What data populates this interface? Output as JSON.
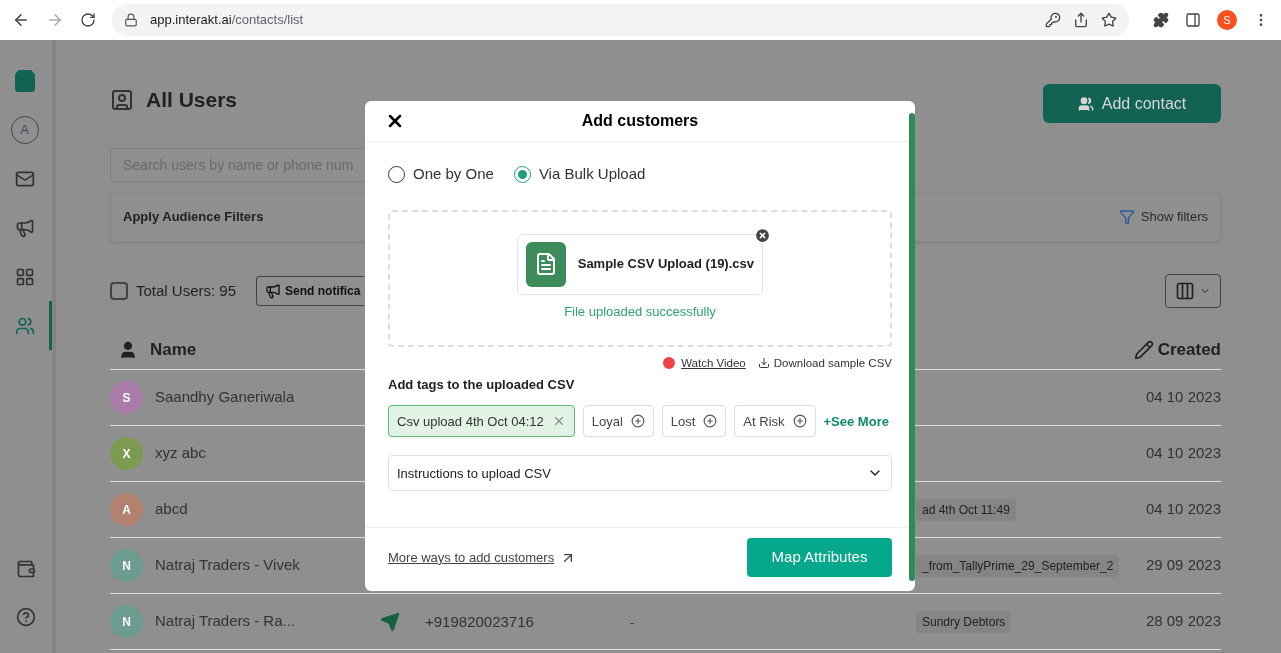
{
  "browser": {
    "url_host": "app.interakt.ai",
    "url_path": "/contacts/list",
    "profile_initial": "S"
  },
  "sidebar": {
    "items": [
      {
        "kind": "logo",
        "selected": false
      },
      {
        "kind": "avatar",
        "label": "A",
        "selected": false
      },
      {
        "kind": "mail",
        "selected": false
      },
      {
        "kind": "megaphone",
        "selected": false
      },
      {
        "kind": "grid",
        "selected": false
      },
      {
        "kind": "users",
        "selected": true
      }
    ],
    "bottom": [
      {
        "kind": "wallet"
      },
      {
        "kind": "help"
      }
    ]
  },
  "page": {
    "title": "All Users",
    "add_button": "Add contact",
    "search": {
      "placeholder": "Search users by name or phone num"
    },
    "filters": {
      "label": "Apply Audience Filters",
      "show": "Show filters"
    },
    "total": {
      "label": "Total Users: 95",
      "checked": false
    },
    "send_button": "Send notifica"
  },
  "table": {
    "columns": [
      "Name",
      "Created"
    ],
    "rows": [
      {
        "initial": "S",
        "color": "#a87ba9",
        "name": "Saandhy Ganeriwala",
        "tags": [],
        "created": "04 10 2023"
      },
      {
        "initial": "X",
        "color": "#7c9a50",
        "name": "xyz abc",
        "tags": [],
        "created": "04 10 2023"
      },
      {
        "initial": "A",
        "color": "#b4806f",
        "name": "abcd",
        "tags": [
          "ad 4th Oct 11:49"
        ],
        "created": "04 10 2023"
      },
      {
        "initial": "N",
        "color": "#6c9c90",
        "name": "Natraj Traders - Vivek",
        "tags": [
          "_from_TallyPrime_29_September_2"
        ],
        "created": "29 09 2023"
      },
      {
        "initial": "N",
        "color": "#6c9c90",
        "name": "Natraj Traders - Ra...",
        "phone": "+919820023716",
        "column_4": "-",
        "tags": [
          "Sundry Debtors"
        ],
        "created": "28 09 2023"
      }
    ]
  },
  "modal": {
    "title": "Add customers",
    "modes": [
      {
        "label": "One by One",
        "selected": false
      },
      {
        "label": "Via Bulk Upload",
        "selected": true
      }
    ],
    "file": {
      "name": "Sample CSV Upload (19).csv",
      "status": "File uploaded successfully"
    },
    "watch_video": "Watch Video",
    "download": "Download sample CSV",
    "tags_label": "Add tags to the uploaded CSV",
    "tags": [
      {
        "label": "Csv upload 4th Oct 04:12",
        "selected": true
      },
      {
        "label": "Loyal",
        "selected": false
      },
      {
        "label": "Lost",
        "selected": false
      },
      {
        "label": "At Risk",
        "selected": false
      }
    ],
    "see_more": "+See More",
    "instructions": {
      "label": "Instructions to upload CSV",
      "expanded": false
    },
    "more_ways": "More ways to add customers",
    "primary_button": "Map Attributes"
  }
}
